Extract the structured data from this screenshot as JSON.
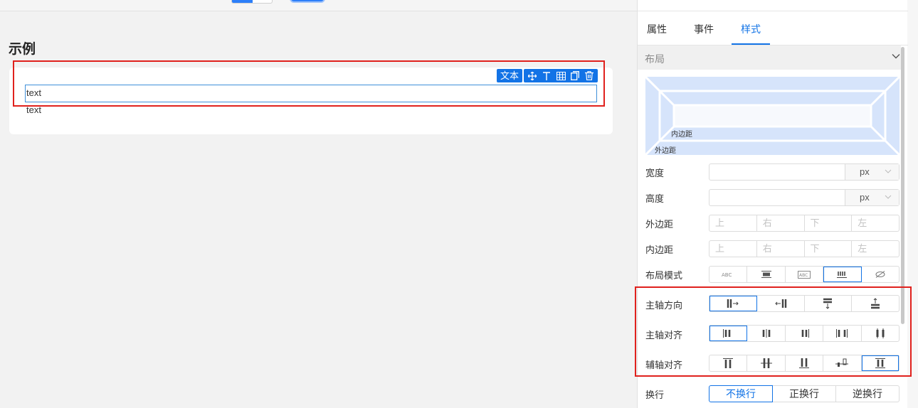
{
  "canvas": {
    "page_title": "示例",
    "component_toolbar": {
      "label": "文本",
      "icons": [
        "move-icon",
        "text-top-icon",
        "table-icon",
        "copy-icon",
        "delete-icon"
      ]
    },
    "text_input_value": "text",
    "text_static": "text"
  },
  "panel": {
    "tabs": [
      {
        "label": "属性",
        "active": false
      },
      {
        "label": "事件",
        "active": false
      },
      {
        "label": "样式",
        "active": true
      }
    ],
    "layout_section": {
      "title": "布局",
      "box_model": {
        "padding_label": "内边距",
        "margin_label": "外边距"
      },
      "width": {
        "label": "宽度",
        "value": "",
        "unit": "px"
      },
      "height": {
        "label": "高度",
        "value": "",
        "unit": "px"
      },
      "margin": {
        "label": "外边距",
        "placeholders": [
          "上",
          "右",
          "下",
          "左"
        ]
      },
      "padding": {
        "label": "内边距",
        "placeholders": [
          "上",
          "右",
          "下",
          "左"
        ]
      },
      "layout_mode": {
        "label": "布局模式",
        "options": [
          "inline",
          "block",
          "inline-block",
          "flex",
          "none"
        ],
        "selected": 3
      },
      "main_axis_direction": {
        "label": "主轴方向",
        "options": [
          "row",
          "row-reverse",
          "column",
          "column-reverse"
        ],
        "selected": 0
      },
      "main_axis_align": {
        "label": "主轴对齐",
        "options": [
          "flex-start",
          "center",
          "flex-end",
          "space-between",
          "space-around"
        ],
        "selected": 0
      },
      "cross_axis_align": {
        "label": "辅轴对齐",
        "options": [
          "flex-start",
          "center",
          "flex-end",
          "baseline",
          "stretch"
        ],
        "selected": 4
      },
      "wrap": {
        "label": "换行",
        "options": [
          "不换行",
          "正换行",
          "逆换行"
        ],
        "selected": 0
      }
    }
  },
  "colors": {
    "accent": "#1273e6",
    "highlight": "#e0211d",
    "boxmodel": "#d6e4fb"
  }
}
